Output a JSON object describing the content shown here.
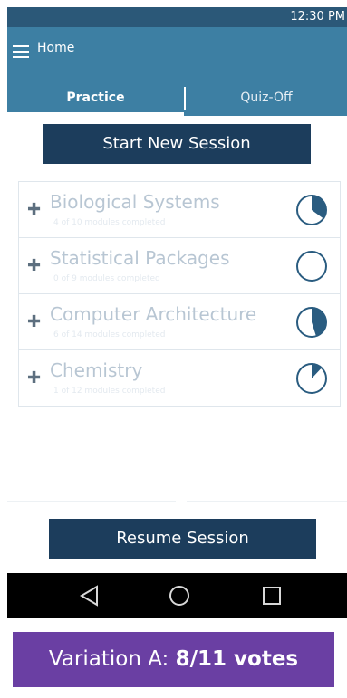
{
  "status_bar": {
    "time": "12:30 PM"
  },
  "app_bar": {
    "title": "Home",
    "menu_icon": "hamburger-menu-icon"
  },
  "tabs": [
    {
      "label": "Practice",
      "selected": true
    },
    {
      "label": "Quiz-Off",
      "selected": false
    }
  ],
  "actions": {
    "start_label": "Start New Session",
    "resume_label": "Resume Session"
  },
  "topics": [
    {
      "title": "Biological Systems",
      "subtitle": "4 of 10 modules completed",
      "progress": 0.35,
      "expand_icon": "plus-icon",
      "progress_icon": "progress-ring-icon"
    },
    {
      "title": "Statistical Packages",
      "subtitle": "0 of 9 modules completed",
      "progress": 0,
      "expand_icon": "plus-icon",
      "progress_icon": "progress-ring-icon"
    },
    {
      "title": "Computer Architecture",
      "subtitle": "6 of 14 modules completed",
      "progress": 0.45,
      "expand_icon": "plus-icon",
      "progress_icon": "progress-ring-icon"
    },
    {
      "title": "Chemistry",
      "subtitle": "1 of 12 modules completed",
      "progress": 0.12,
      "expand_icon": "plus-icon",
      "progress_icon": "progress-ring-icon"
    }
  ],
  "nav_bar": {
    "back_icon": "back-triangle-icon",
    "home_icon": "home-circle-icon",
    "recents_icon": "recents-square-icon"
  },
  "caption": {
    "prefix": "Variation A:",
    "votes": "8/11 votes"
  },
  "colors": {
    "status_bar": "#2b5878",
    "app_bar": "#3d7fa3",
    "button": "#1c3d5c",
    "ring": "#2a5c80",
    "caption": "#6a3fa3"
  }
}
